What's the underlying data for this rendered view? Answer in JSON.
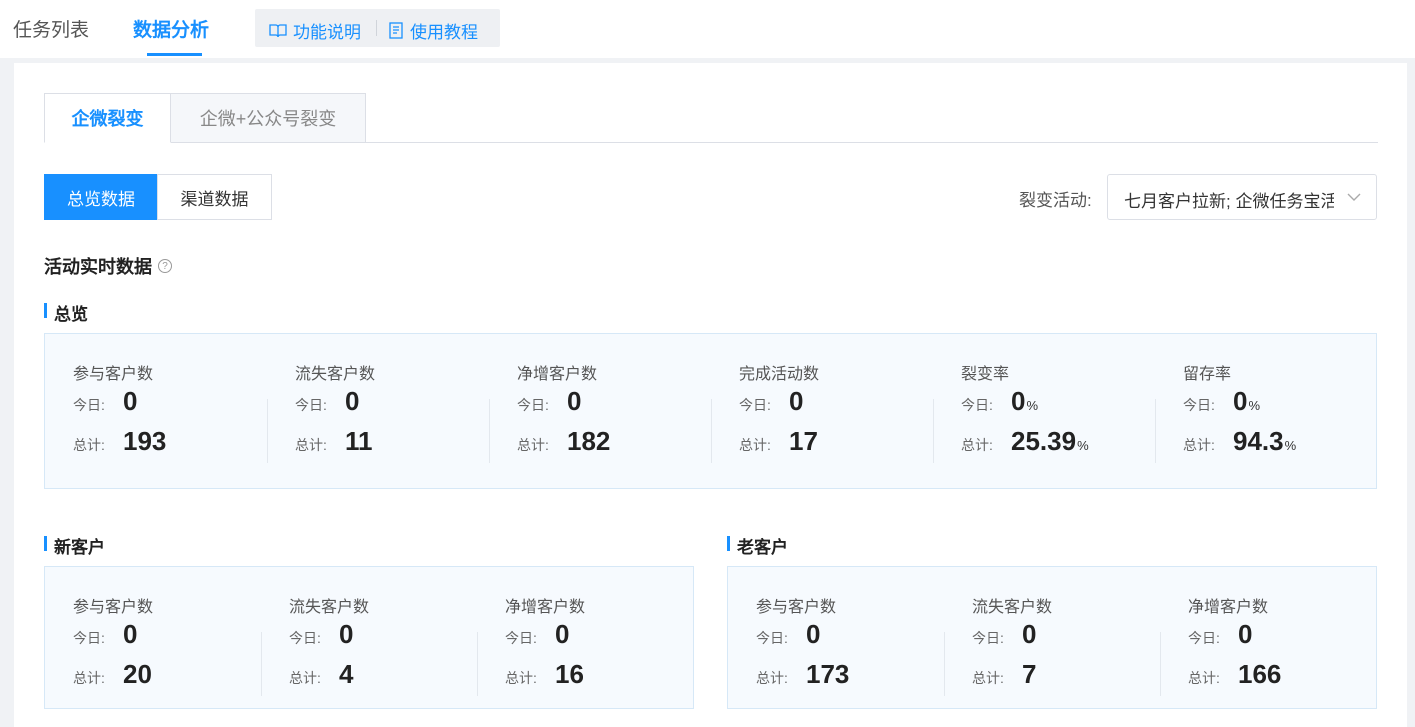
{
  "nav": {
    "tabs": [
      {
        "label": "任务列表",
        "active": false
      },
      {
        "label": "数据分析",
        "active": true
      }
    ],
    "help": {
      "feature_label": "功能说明",
      "tutorial_label": "使用教程"
    }
  },
  "card": {
    "top_tabs": [
      {
        "label": "企微裂变",
        "active": true
      },
      {
        "label": "企微+公众号裂变",
        "active": false
      }
    ],
    "segments": [
      {
        "label": "总览数据",
        "active": true
      },
      {
        "label": "渠道数据",
        "active": false
      }
    ],
    "activity_select": {
      "label": "裂变活动:",
      "value": "七月客户拉新; 企微任务宝活动"
    },
    "section_title": "活动实时数据",
    "help_mark": "?",
    "labels": {
      "today": "今日:",
      "total": "总计:"
    },
    "overview": {
      "title": "总览",
      "stats": [
        {
          "name": "参与客户数",
          "today": "0",
          "total": "193",
          "unit": ""
        },
        {
          "name": "流失客户数",
          "today": "0",
          "total": "11",
          "unit": ""
        },
        {
          "name": "净增客户数",
          "today": "0",
          "total": "182",
          "unit": ""
        },
        {
          "name": "完成活动数",
          "today": "0",
          "total": "17",
          "unit": ""
        },
        {
          "name": "裂变率",
          "today": "0",
          "total": "25.39",
          "unit": "%"
        },
        {
          "name": "留存率",
          "today": "0",
          "total": "94.3",
          "unit": "%"
        }
      ]
    },
    "new_customers": {
      "title": "新客户",
      "stats": [
        {
          "name": "参与客户数",
          "today": "0",
          "total": "20"
        },
        {
          "name": "流失客户数",
          "today": "0",
          "total": "4"
        },
        {
          "name": "净增客户数",
          "today": "0",
          "total": "16"
        }
      ]
    },
    "old_customers": {
      "title": "老客户",
      "stats": [
        {
          "name": "参与客户数",
          "today": "0",
          "total": "173"
        },
        {
          "name": "流失客户数",
          "today": "0",
          "total": "7"
        },
        {
          "name": "净增客户数",
          "today": "0",
          "total": "166"
        }
      ]
    }
  },
  "colors": {
    "accent": "#1890ff",
    "box_bg": "#f6fafe",
    "box_border": "#d6e8f7"
  }
}
